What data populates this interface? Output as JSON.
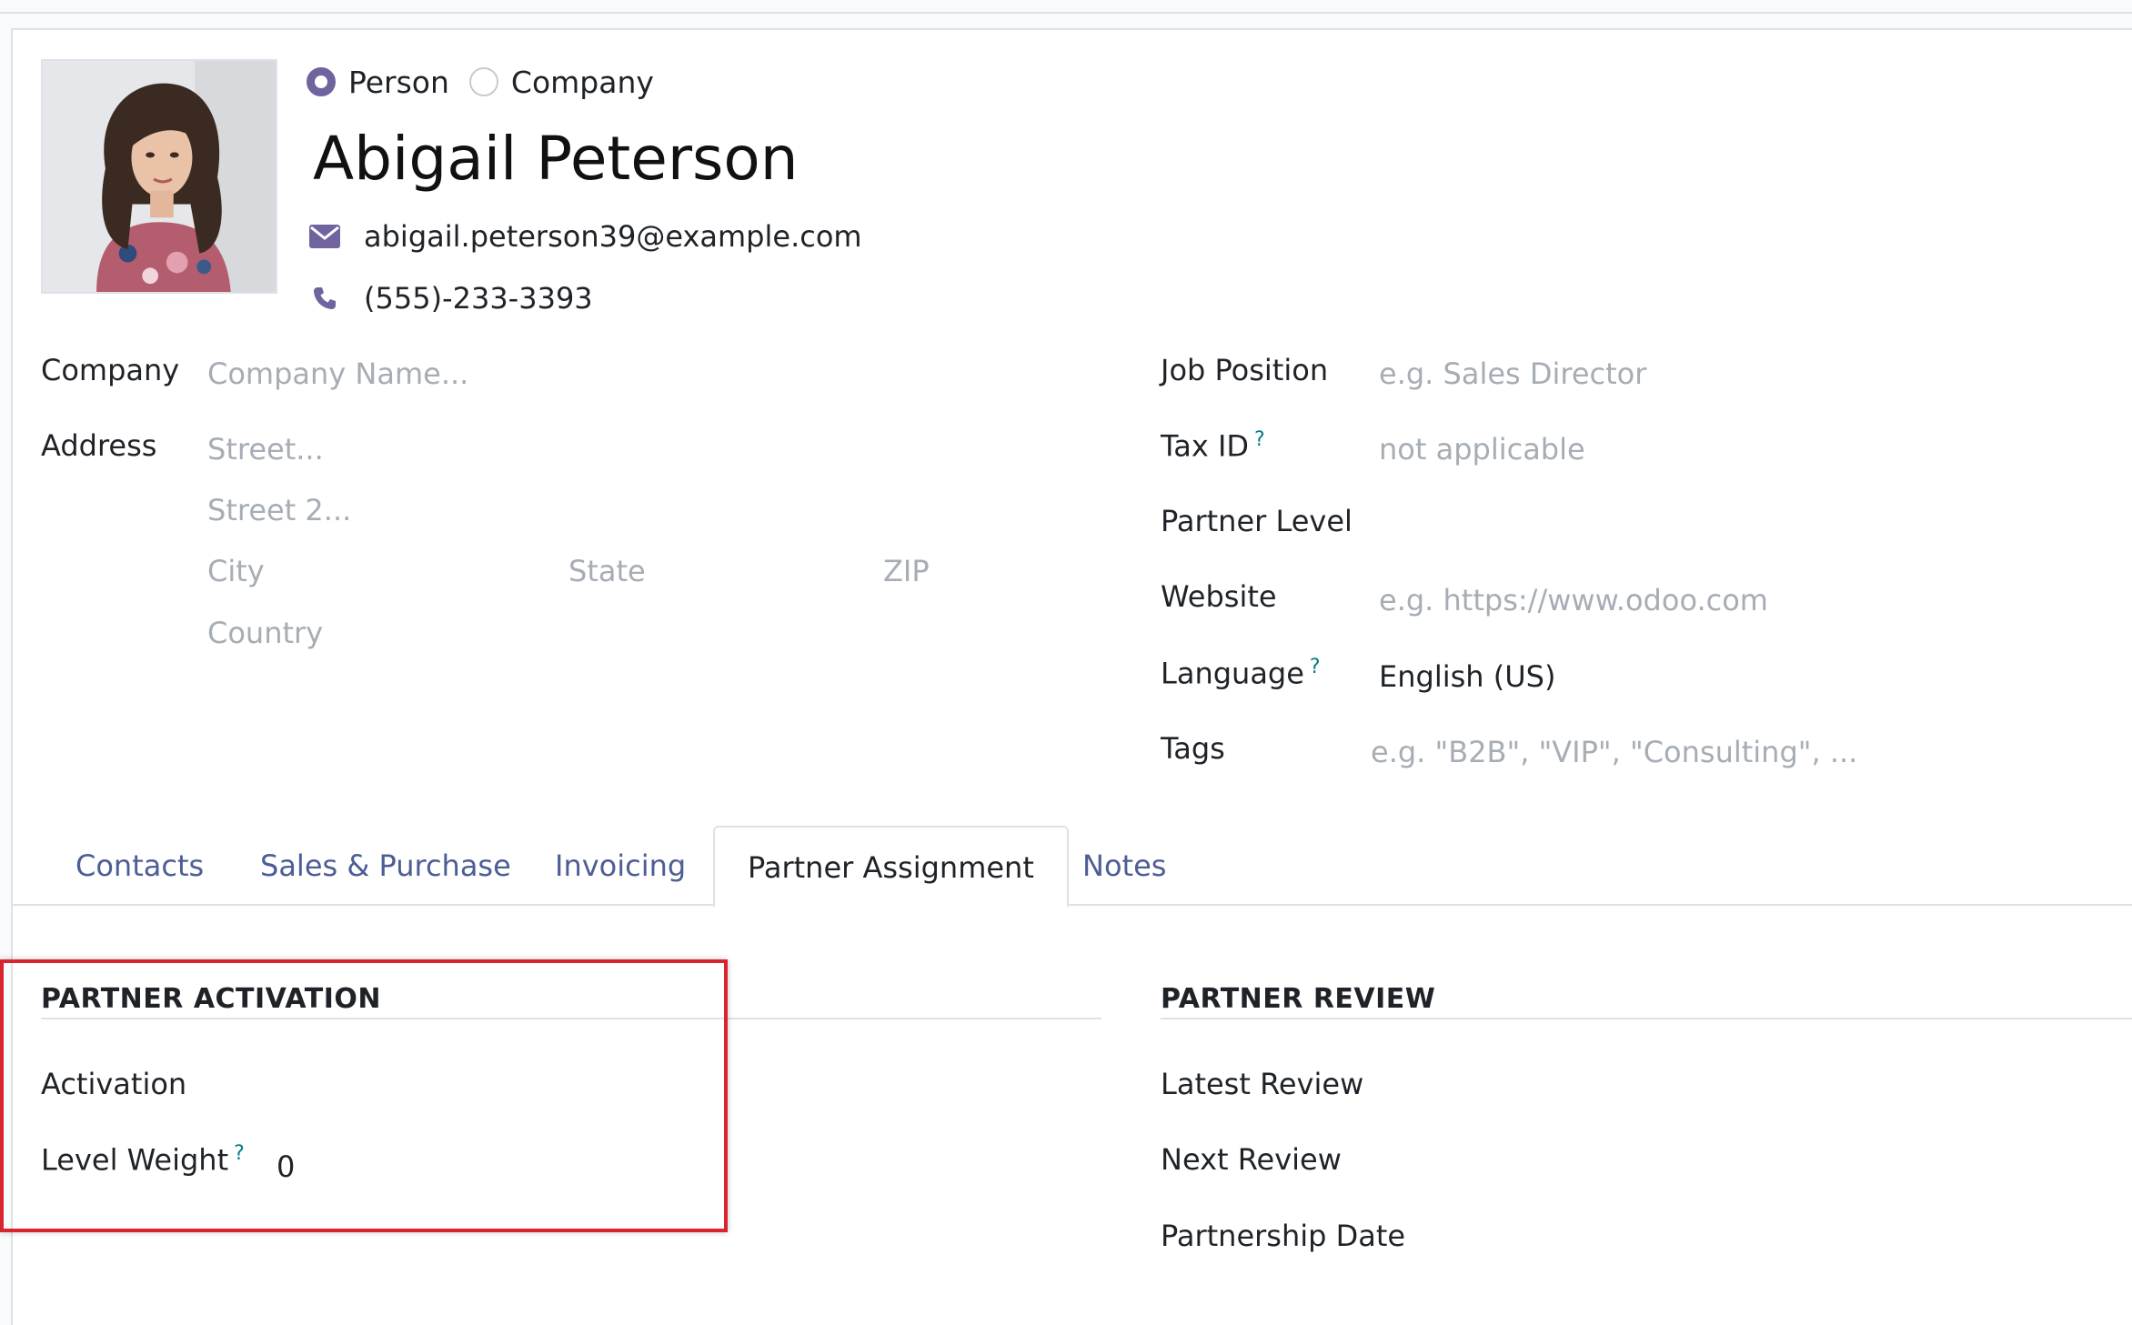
{
  "header": {
    "type_options": [
      {
        "label": "Person",
        "checked": true
      },
      {
        "label": "Company",
        "checked": false
      }
    ],
    "name": "Abigail Peterson",
    "email": "abigail.peterson39@example.com",
    "phone": "(555)-233-3393"
  },
  "left_fields": {
    "company_label": "Company",
    "company_placeholder": "Company Name...",
    "address_label": "Address",
    "street_placeholder": "Street...",
    "street2_placeholder": "Street 2...",
    "city_placeholder": "City",
    "state_placeholder": "State",
    "zip_placeholder": "ZIP",
    "country_placeholder": "Country"
  },
  "right_fields": {
    "job_position_label": "Job Position",
    "job_position_placeholder": "e.g. Sales Director",
    "tax_id_label": "Tax ID",
    "tax_id_help": "?",
    "tax_id_placeholder": "not applicable",
    "partner_level_label": "Partner Level",
    "website_label": "Website",
    "website_placeholder": "e.g. https://www.odoo.com",
    "language_label": "Language",
    "language_help": "?",
    "language_value": "English (US)",
    "tags_label": "Tags",
    "tags_placeholder": "e.g. \"B2B\", \"VIP\", \"Consulting\", ..."
  },
  "tabs": [
    {
      "label": "Contacts",
      "active": false
    },
    {
      "label": "Sales & Purchase",
      "active": false
    },
    {
      "label": "Invoicing",
      "active": false
    },
    {
      "label": "Partner Assignment",
      "active": true
    },
    {
      "label": "Notes",
      "active": false
    }
  ],
  "partner_activation": {
    "title": "PARTNER ACTIVATION",
    "activation_label": "Activation",
    "level_weight_label": "Level Weight",
    "level_weight_help": "?",
    "level_weight_value": "0"
  },
  "partner_review": {
    "title": "PARTNER REVIEW",
    "latest_review_label": "Latest Review",
    "next_review_label": "Next Review",
    "partnership_date_label": "Partnership Date"
  },
  "colors": {
    "accent": "#71639e",
    "tab_link": "#4d5d95",
    "help_marker": "#017e84",
    "highlight_border": "#d9232e"
  },
  "icons": {
    "email": "envelope-icon",
    "phone": "phone-icon"
  }
}
